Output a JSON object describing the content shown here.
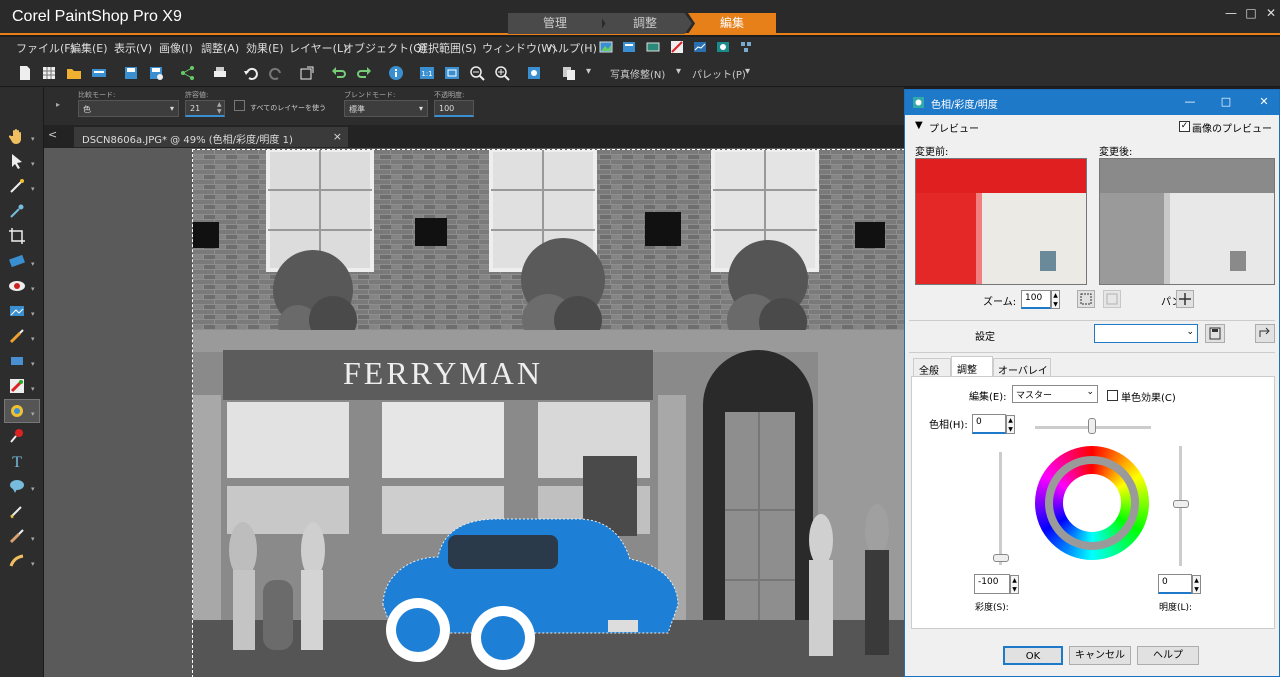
{
  "app": {
    "title": "Corel PaintShop Pro X9",
    "workspace_tabs": [
      "管理",
      "調整",
      "編集"
    ]
  },
  "menu": {
    "items": [
      "ファイル(F)",
      "編集(E)",
      "表示(V)",
      "画像(I)",
      "調整(A)",
      "効果(E)",
      "レイヤー(L)",
      "オブジェクト(O)",
      "選択範囲(S)",
      "ウィンドウ(W)",
      "ヘルプ(H)"
    ]
  },
  "toolbar": {
    "photo_fix_label": "写真修整(N)",
    "palette_label": "パレット(P)"
  },
  "options": {
    "compare_mode_label": "比較モード:",
    "compare_mode_value": "色",
    "tolerance_label": "許容値:",
    "tolerance_value": "21",
    "all_layers_label": "すべてのレイヤーを使う",
    "blend_mode_label": "ブレンドモード:",
    "blend_mode_value": "標準",
    "opacity_label": "不透明度:",
    "opacity_value": "100"
  },
  "document": {
    "tab_label": "DSCN8606a.JPG* @  49% (色相/彩度/明度 1)",
    "close": "×",
    "scroll_left": "<"
  },
  "photo": {
    "sign": "FERRYMAN"
  },
  "dialog": {
    "title": "色相/彩度/明度",
    "preview_section": "プレビュー",
    "image_preview_label": "画像のプレビュー",
    "before_label": "変更前:",
    "after_label": "変更後:",
    "zoom_label": "ズーム:",
    "zoom_value": "100",
    "pan_label": "パン:",
    "settings_label": "設定",
    "settings_value": "",
    "tabs": [
      "全般",
      "調整",
      "オーバレイ"
    ],
    "edit_label": "編集(E):",
    "edit_value": "マスター",
    "colorize_label": "単色効果(C)",
    "hue_label": "色相(H):",
    "hue_value": "0",
    "saturation_label": "彩度(S):",
    "saturation_value": "-100",
    "lightness_label": "明度(L):",
    "lightness_value": "0",
    "ok_label": "OK",
    "cancel_label": "キャンセル",
    "help_label": "ヘルプ"
  },
  "colors": {
    "accent": "#e8801a",
    "dialog_title": "#1f79c9",
    "car_blue": "#1e7fd6"
  }
}
